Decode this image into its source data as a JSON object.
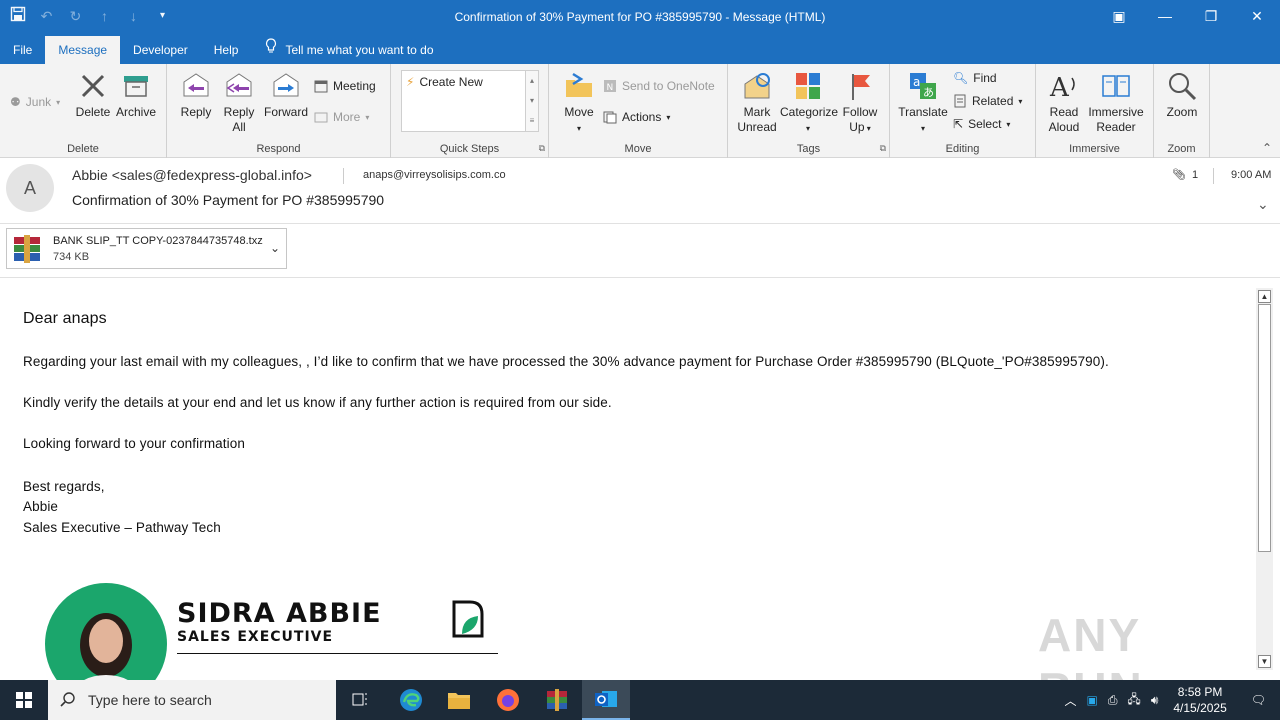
{
  "window": {
    "title": "Confirmation of 30% Payment for PO #385995790  -  Message (HTML)"
  },
  "menu": {
    "tabs": [
      "File",
      "Message",
      "Developer",
      "Help"
    ],
    "tell_me": "Tell me what you want to do"
  },
  "ribbon": {
    "delete_group": {
      "label": "Delete",
      "junk": "Junk",
      "delete": "Delete",
      "archive": "Archive"
    },
    "respond_group": {
      "label": "Respond",
      "reply": "Reply",
      "reply_all_1": "Reply",
      "reply_all_2": "All",
      "forward": "Forward",
      "meeting": "Meeting",
      "more": "More"
    },
    "quick_steps": {
      "label": "Quick Steps",
      "create_new": "Create New"
    },
    "move_group": {
      "label": "Move",
      "move": "Move",
      "onenote": "Send to OneNote",
      "actions": "Actions"
    },
    "tags_group": {
      "label": "Tags",
      "mark_unread_1": "Mark",
      "mark_unread_2": "Unread",
      "categorize": "Categorize",
      "follow_up_1": "Follow",
      "follow_up_2": "Up"
    },
    "editing_group": {
      "label": "Editing",
      "translate": "Translate",
      "find": "Find",
      "related": "Related",
      "select": "Select"
    },
    "immersive_group": {
      "label": "Immersive",
      "read_aloud_1": "Read",
      "read_aloud_2": "Aloud",
      "immersive_reader_1": "Immersive",
      "immersive_reader_2": "Reader"
    },
    "zoom_group": {
      "label": "Zoom",
      "zoom": "Zoom"
    }
  },
  "message": {
    "avatar_initial": "A",
    "from": "Abbie <sales@fedexpress-global.info>",
    "to": "anaps@virreysolisips.com.co",
    "subject": "Confirmation of 30% Payment for PO #385995790",
    "attachment_count": "1",
    "time": "9:00 AM",
    "attachment": {
      "name": "BANK SLIP_TT COPY-0237844735748.txz",
      "size": "734 KB"
    },
    "body": {
      "greeting": "Dear anaps",
      "line1": "Regarding your last email with my colleagues, , I’d like to confirm that we have processed the 30% advance payment for Purchase Order #385995790 (BLQuote_'PO#385995790).",
      "line2": "Kindly verify the details at your end and let us know if any further action is required from our side.",
      "line3": "Looking forward to your confirmation",
      "closing": "Best regards,",
      "name": "Abbie",
      "title": "Sales Executive – Pathway Tech"
    },
    "signature": {
      "name": "SIDRA ABBIE",
      "title": "SALES EXECUTIVE"
    }
  },
  "watermark": "ANY RUN",
  "taskbar": {
    "search_placeholder": "Type here to search",
    "time": "8:58 PM",
    "date": "4/15/2025"
  },
  "colors": {
    "accent": "#1d6fbf",
    "taskbar": "#1c2a38",
    "signature_green": "#1ba66c"
  }
}
